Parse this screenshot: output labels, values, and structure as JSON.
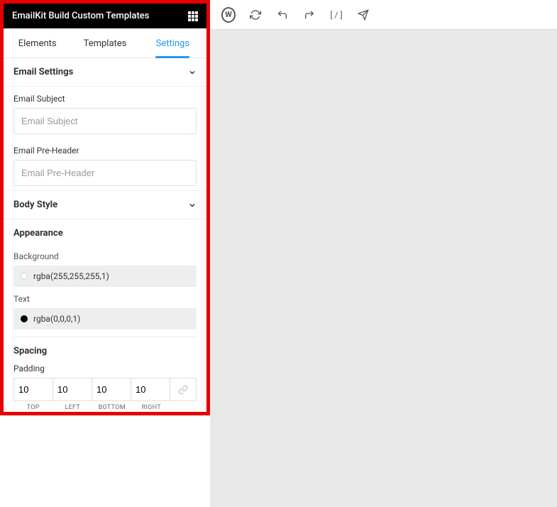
{
  "sidebar": {
    "title": "EmailKit Build Custom Templates",
    "tabs": [
      "Elements",
      "Templates",
      "Settings"
    ],
    "activeTab": 2,
    "sections": {
      "emailSettings": {
        "title": "Email Settings",
        "fields": {
          "subject": {
            "label": "Email Subject",
            "placeholder": "Email Subject",
            "value": ""
          },
          "preheader": {
            "label": "Email Pre-Header",
            "placeholder": "Email Pre-Header",
            "value": ""
          }
        }
      },
      "bodyStyle": {
        "title": "Body Style",
        "appearance": {
          "heading": "Appearance",
          "background": {
            "label": "Background",
            "value": "rgba(255,255,255,1)"
          },
          "text": {
            "label": "Text",
            "value": "rgba(0,0,0,1)"
          }
        },
        "spacing": {
          "heading": "Spacing",
          "padding": {
            "label": "Padding",
            "top": "10",
            "left": "10",
            "bottom": "10",
            "right": "10",
            "labels": {
              "top": "TOP",
              "left": "LEFT",
              "bottom": "BOTTOM",
              "right": "RIGHT"
            }
          }
        }
      }
    }
  },
  "toolbar": {
    "icons": [
      "wordpress",
      "refresh",
      "undo",
      "redo",
      "shortcode",
      "send"
    ]
  }
}
